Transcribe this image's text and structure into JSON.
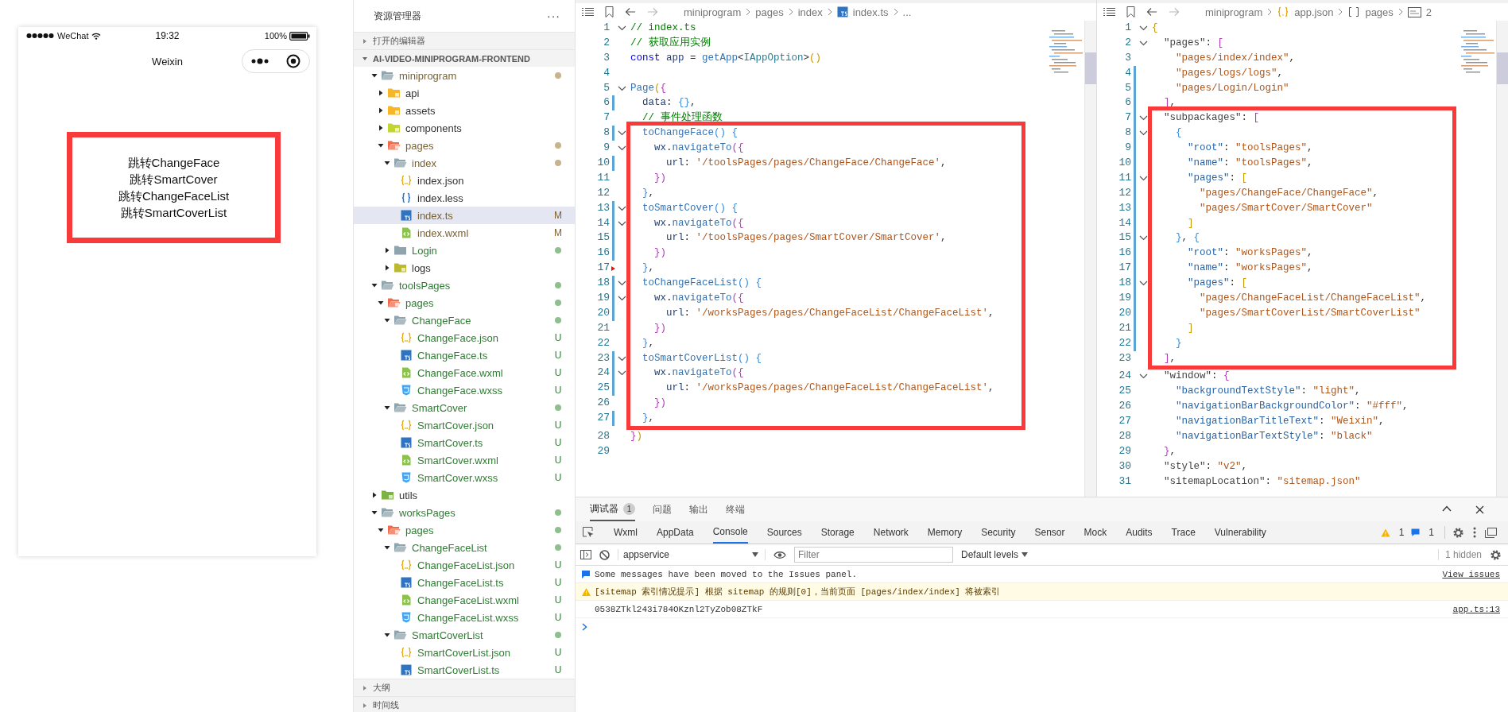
{
  "simulator": {
    "status_bar": {
      "carrier": "WeChat",
      "time": "19:32",
      "battery": "100%"
    },
    "nav_title": "Weixin",
    "page": {
      "framed": true,
      "links": [
        "跳转ChangeFace",
        "跳转SmartCover",
        "跳转ChangeFaceList",
        "跳转SmartCoverList"
      ]
    }
  },
  "explorer": {
    "title": "资源管理器",
    "more": "···",
    "sections": [
      {
        "title": "打开的编辑器",
        "expanded": false
      },
      {
        "title": "AI-VIDEO-MINIPROGRAM-FRONTEND",
        "expanded": true,
        "tree": [
          {
            "name": "miniprogram",
            "kind": "folder",
            "expanded": true,
            "selected": false,
            "modified": true,
            "untracked": false,
            "children": [
              {
                "name": "api",
                "kind": "api",
                "expanded": false,
                "selected": false,
                "modified": false,
                "untracked": false
              },
              {
                "name": "assets",
                "kind": "assets",
                "expanded": false,
                "selected": false,
                "modified": false,
                "untracked": false
              },
              {
                "name": "components",
                "kind": "components",
                "expanded": false,
                "selected": false,
                "modified": false,
                "untracked": false
              },
              {
                "name": "pages",
                "kind": "pages",
                "expanded": true,
                "selected": false,
                "modified": true,
                "untracked": false,
                "children": [
                  {
                    "name": "index",
                    "kind": "folder",
                    "expanded": true,
                    "selected": false,
                    "modified": true,
                    "untracked": false,
                    "children": [
                      {
                        "name": "index.json",
                        "kind": "json",
                        "selected": false,
                        "modified": false,
                        "untracked": false
                      },
                      {
                        "name": "index.less",
                        "kind": "less",
                        "selected": false,
                        "modified": false,
                        "untracked": false
                      },
                      {
                        "name": "index.ts",
                        "kind": "ts",
                        "selected": true,
                        "modified": true,
                        "untracked": false,
                        "badge": "M"
                      },
                      {
                        "name": "index.wxml",
                        "kind": "wxml",
                        "selected": false,
                        "modified": true,
                        "untracked": false,
                        "badge": "M"
                      }
                    ]
                  },
                  {
                    "name": "Login",
                    "kind": "folder",
                    "expanded": false,
                    "selected": false,
                    "modified": false,
                    "untracked": true
                  },
                  {
                    "name": "logs",
                    "kind": "logs",
                    "expanded": false,
                    "selected": false,
                    "modified": false,
                    "untracked": false
                  }
                ]
              }
            ]
          },
          {
            "name": "toolsPages",
            "kind": "folder",
            "expanded": true,
            "selected": false,
            "modified": false,
            "untracked": true,
            "children": [
              {
                "name": "pages",
                "kind": "pages",
                "expanded": true,
                "selected": false,
                "modified": false,
                "untracked": true,
                "children": [
                  {
                    "name": "ChangeFace",
                    "kind": "folder",
                    "expanded": true,
                    "selected": false,
                    "modified": false,
                    "untracked": true,
                    "children": [
                      {
                        "name": "ChangeFace.json",
                        "kind": "json",
                        "selected": false,
                        "modified": false,
                        "untracked": true,
                        "badge": "U"
                      },
                      {
                        "name": "ChangeFace.ts",
                        "kind": "ts",
                        "selected": false,
                        "modified": false,
                        "untracked": true,
                        "badge": "U"
                      },
                      {
                        "name": "ChangeFace.wxml",
                        "kind": "wxml",
                        "selected": false,
                        "modified": false,
                        "untracked": true,
                        "badge": "U"
                      },
                      {
                        "name": "ChangeFace.wxss",
                        "kind": "wxss",
                        "selected": false,
                        "modified": false,
                        "untracked": true,
                        "badge": "U"
                      }
                    ]
                  },
                  {
                    "name": "SmartCover",
                    "kind": "folder",
                    "expanded": true,
                    "selected": false,
                    "modified": false,
                    "untracked": true,
                    "children": [
                      {
                        "name": "SmartCover.json",
                        "kind": "json",
                        "selected": false,
                        "modified": false,
                        "untracked": true,
                        "badge": "U"
                      },
                      {
                        "name": "SmartCover.ts",
                        "kind": "ts",
                        "selected": false,
                        "modified": false,
                        "untracked": true,
                        "badge": "U"
                      },
                      {
                        "name": "SmartCover.wxml",
                        "kind": "wxml",
                        "selected": false,
                        "modified": false,
                        "untracked": true,
                        "badge": "U"
                      },
                      {
                        "name": "SmartCover.wxss",
                        "kind": "wxss",
                        "selected": false,
                        "modified": false,
                        "untracked": true,
                        "badge": "U"
                      }
                    ]
                  }
                ]
              }
            ]
          },
          {
            "name": "utils",
            "kind": "utils",
            "expanded": false,
            "selected": false,
            "modified": false,
            "untracked": false
          },
          {
            "name": "worksPages",
            "kind": "folder",
            "expanded": true,
            "selected": false,
            "modified": false,
            "untracked": true,
            "children": [
              {
                "name": "pages",
                "kind": "pages",
                "expanded": true,
                "selected": false,
                "modified": false,
                "untracked": true,
                "children": [
                  {
                    "name": "ChangeFaceList",
                    "kind": "folder",
                    "expanded": true,
                    "selected": false,
                    "modified": false,
                    "untracked": true,
                    "children": [
                      {
                        "name": "ChangeFaceList.json",
                        "kind": "json",
                        "selected": false,
                        "modified": false,
                        "untracked": true,
                        "badge": "U"
                      },
                      {
                        "name": "ChangeFaceList.ts",
                        "kind": "ts",
                        "selected": false,
                        "modified": false,
                        "untracked": true,
                        "badge": "U"
                      },
                      {
                        "name": "ChangeFaceList.wxml",
                        "kind": "wxml",
                        "selected": false,
                        "modified": false,
                        "untracked": true,
                        "badge": "U"
                      },
                      {
                        "name": "ChangeFaceList.wxss",
                        "kind": "wxss",
                        "selected": false,
                        "modified": false,
                        "untracked": true,
                        "badge": "U"
                      }
                    ]
                  },
                  {
                    "name": "SmartCoverList",
                    "kind": "folder",
                    "expanded": true,
                    "selected": false,
                    "modified": false,
                    "untracked": true,
                    "children": [
                      {
                        "name": "SmartCoverList.json",
                        "kind": "json",
                        "selected": false,
                        "modified": false,
                        "untracked": true,
                        "badge": "U"
                      },
                      {
                        "name": "SmartCoverList.ts",
                        "kind": "ts",
                        "selected": false,
                        "modified": false,
                        "untracked": true,
                        "badge": "U"
                      }
                    ]
                  }
                ]
              }
            ]
          }
        ]
      },
      {
        "title": "大纲",
        "expanded": false
      },
      {
        "title": "时间线",
        "expanded": false
      }
    ]
  },
  "editors": [
    {
      "breadcrumb": [
        {
          "text": "miniprogram"
        },
        {
          "text": "pages"
        },
        {
          "text": "index"
        },
        {
          "text": "index.ts",
          "kind": "ts"
        },
        {
          "text": "..."
        }
      ],
      "blocks": [
        {
          "framed": false,
          "lines": [
            {
              "number": "1",
              "foldable": true,
              "tokens": [
                {
                  "text": "// index.ts",
                  "kind": "comment"
                }
              ]
            },
            {
              "number": "2",
              "foldable": false,
              "tokens": [
                {
                  "text": "// 获取应用实例",
                  "kind": "comment"
                }
              ]
            },
            {
              "number": "3",
              "foldable": false,
              "tokens": [
                {
                  "text": "const",
                  "kind": "keyword"
                },
                {
                  "text": " app",
                  "kind": "variable"
                },
                {
                  "text": " = ",
                  "kind": "plain"
                },
                {
                  "text": "getApp",
                  "kind": "function"
                },
                {
                  "text": "<",
                  "kind": "plain"
                },
                {
                  "text": "IAppOption",
                  "kind": "type"
                },
                {
                  "text": ">",
                  "kind": "plain"
                },
                {
                  "text": "()",
                  "kind": "bracket1"
                }
              ]
            },
            {
              "number": "4",
              "foldable": false
            },
            {
              "number": "5",
              "foldable": true,
              "tokens": [
                {
                  "text": "Page",
                  "kind": "function"
                },
                {
                  "text": "(",
                  "kind": "bracket1"
                },
                {
                  "text": "{",
                  "kind": "bracket2"
                }
              ]
            },
            {
              "number": "6",
              "foldable": false,
              "changed": true,
              "tokens": [
                {
                  "text": "  data",
                  "kind": "variable"
                },
                {
                  "text": ": ",
                  "kind": "plain"
                },
                {
                  "text": "{}",
                  "kind": "bracket3"
                },
                {
                  "text": ",",
                  "kind": "plain"
                }
              ]
            },
            {
              "number": "7",
              "foldable": false,
              "tokens": [
                {
                  "text": "  // 事件处理函数",
                  "kind": "comment"
                }
              ]
            }
          ]
        },
        {
          "framed": true,
          "lines": [
            {
              "number": "8",
              "foldable": true,
              "changed": true,
              "tokens": [
                {
                  "text": "  toChangeFace",
                  "kind": "function"
                },
                {
                  "text": "() {",
                  "kind": "bracket3"
                }
              ]
            },
            {
              "number": "9",
              "foldable": true,
              "tokens": [
                {
                  "text": "    wx",
                  "kind": "variable"
                },
                {
                  "text": ".",
                  "kind": "plain"
                },
                {
                  "text": "navigateTo",
                  "kind": "function"
                },
                {
                  "text": "({",
                  "kind": "bracket2"
                }
              ]
            },
            {
              "number": "10",
              "foldable": false,
              "changed": true,
              "tokens": [
                {
                  "text": "      url",
                  "kind": "variable"
                },
                {
                  "text": ": ",
                  "kind": "plain"
                },
                {
                  "text": "'/toolsPages/pages/ChangeFace/ChangeFace'",
                  "kind": "string"
                },
                {
                  "text": ",",
                  "kind": "plain"
                }
              ]
            },
            {
              "number": "11",
              "foldable": false,
              "tokens": [
                {
                  "text": "    })",
                  "kind": "bracket2"
                }
              ]
            },
            {
              "number": "12",
              "foldable": false,
              "tokens": [
                {
                  "text": "  }",
                  "kind": "bracket3"
                },
                {
                  "text": ",",
                  "kind": "plain"
                }
              ]
            },
            {
              "number": "13",
              "foldable": true,
              "changed": true,
              "tokens": [
                {
                  "text": "  toSmartCover",
                  "kind": "function"
                },
                {
                  "text": "() {",
                  "kind": "bracket3"
                }
              ]
            },
            {
              "number": "14",
              "foldable": true,
              "changed": true,
              "tokens": [
                {
                  "text": "    wx",
                  "kind": "variable"
                },
                {
                  "text": ".",
                  "kind": "plain"
                },
                {
                  "text": "navigateTo",
                  "kind": "function"
                },
                {
                  "text": "({",
                  "kind": "bracket2"
                }
              ]
            },
            {
              "number": "15",
              "foldable": false,
              "changed": true,
              "tokens": [
                {
                  "text": "      url",
                  "kind": "variable"
                },
                {
                  "text": ": ",
                  "kind": "plain"
                },
                {
                  "text": "'/toolsPages/pages/SmartCover/SmartCover'",
                  "kind": "string"
                },
                {
                  "text": ",",
                  "kind": "plain"
                }
              ]
            },
            {
              "number": "16",
              "foldable": false,
              "changed": true,
              "tokens": [
                {
                  "text": "    })",
                  "kind": "bracket2"
                }
              ]
            },
            {
              "number": "17",
              "foldable": false,
              "deleted": true,
              "tokens": [
                {
                  "text": "  }",
                  "kind": "bracket3"
                },
                {
                  "text": ",",
                  "kind": "plain"
                }
              ]
            },
            {
              "number": "18",
              "foldable": true,
              "changed": true,
              "tokens": [
                {
                  "text": "  toChangeFaceList",
                  "kind": "function"
                },
                {
                  "text": "() {",
                  "kind": "bracket3"
                }
              ]
            },
            {
              "number": "19",
              "foldable": true,
              "changed": true,
              "tokens": [
                {
                  "text": "    wx",
                  "kind": "variable"
                },
                {
                  "text": ".",
                  "kind": "plain"
                },
                {
                  "text": "navigateTo",
                  "kind": "function"
                },
                {
                  "text": "({",
                  "kind": "bracket2"
                }
              ]
            },
            {
              "number": "20",
              "foldable": false,
              "changed": true,
              "tokens": [
                {
                  "text": "      url",
                  "kind": "variable"
                },
                {
                  "text": ": ",
                  "kind": "plain"
                },
                {
                  "text": "'/worksPages/pages/ChangeFaceList/ChangeFaceList'",
                  "kind": "string"
                },
                {
                  "text": ",",
                  "kind": "plain"
                }
              ]
            },
            {
              "number": "21",
              "foldable": false,
              "tokens": [
                {
                  "text": "    })",
                  "kind": "bracket2"
                }
              ]
            },
            {
              "number": "22",
              "foldable": false,
              "tokens": [
                {
                  "text": "  }",
                  "kind": "bracket3"
                },
                {
                  "text": ",",
                  "kind": "plain"
                }
              ]
            },
            {
              "number": "23",
              "foldable": true,
              "changed": true,
              "tokens": [
                {
                  "text": "  toSmartCoverList",
                  "kind": "function"
                },
                {
                  "text": "() {",
                  "kind": "bracket3"
                }
              ]
            },
            {
              "number": "24",
              "foldable": true,
              "changed": true,
              "tokens": [
                {
                  "text": "    wx",
                  "kind": "variable"
                },
                {
                  "text": ".",
                  "kind": "plain"
                },
                {
                  "text": "navigateTo",
                  "kind": "function"
                },
                {
                  "text": "({",
                  "kind": "bracket2"
                }
              ]
            },
            {
              "number": "25",
              "foldable": false,
              "changed": true,
              "tokens": [
                {
                  "text": "      url",
                  "kind": "variable"
                },
                {
                  "text": ": ",
                  "kind": "plain"
                },
                {
                  "text": "'/worksPages/pages/ChangeFaceList/ChangeFaceList'",
                  "kind": "string"
                },
                {
                  "text": ",",
                  "kind": "plain"
                }
              ]
            },
            {
              "number": "26",
              "foldable": false,
              "tokens": [
                {
                  "text": "    })",
                  "kind": "bracket2"
                }
              ]
            },
            {
              "number": "27",
              "foldable": false,
              "changed": true,
              "tokens": [
                {
                  "text": "  }",
                  "kind": "bracket3"
                },
                {
                  "text": ",",
                  "kind": "plain"
                }
              ]
            }
          ]
        },
        {
          "framed": false,
          "lines": [
            {
              "number": "28",
              "foldable": false,
              "tokens": [
                {
                  "text": "}",
                  "kind": "bracket2"
                },
                {
                  "text": ")",
                  "kind": "bracket1"
                }
              ]
            },
            {
              "number": "29",
              "foldable": false
            }
          ]
        }
      ]
    },
    {
      "breadcrumb": [
        {
          "text": "miniprogram"
        },
        {
          "text": "app.json",
          "kind": "json"
        },
        {
          "text": "pages",
          "kind": "array"
        },
        {
          "text": "2",
          "kind": "string"
        }
      ],
      "blocks": [
        {
          "framed": false,
          "lines": [
            {
              "number": "1",
              "foldable": true,
              "tokens": [
                {
                  "text": "{",
                  "kind": "bracket1"
                }
              ]
            },
            {
              "number": "2",
              "foldable": true,
              "tokens": [
                {
                  "text": "  \"pages\"",
                  "kind": "topkey"
                },
                {
                  "text": ": ",
                  "kind": "plain"
                },
                {
                  "text": "[",
                  "kind": "bracket2"
                }
              ]
            },
            {
              "number": "3",
              "foldable": false,
              "tokens": [
                {
                  "text": "    \"pages/index/index\"",
                  "kind": "string"
                },
                {
                  "text": ",",
                  "kind": "plain"
                }
              ]
            },
            {
              "number": "4",
              "foldable": false,
              "changed": true,
              "tokens": [
                {
                  "text": "    \"pages/logs/logs\"",
                  "kind": "string"
                },
                {
                  "text": ",",
                  "kind": "plain"
                }
              ]
            },
            {
              "number": "5",
              "foldable": false,
              "changed": true,
              "tokens": [
                {
                  "text": "    \"pages/Login/Login\"",
                  "kind": "string"
                }
              ]
            },
            {
              "number": "6",
              "foldable": false,
              "changed": true,
              "tokens": [
                {
                  "text": "  ]",
                  "kind": "bracket2"
                },
                {
                  "text": ",",
                  "kind": "plain"
                }
              ]
            }
          ]
        },
        {
          "framed": true,
          "lines": [
            {
              "number": "7",
              "foldable": true,
              "changed": true,
              "tokens": [
                {
                  "text": "  \"subpackages\"",
                  "kind": "topkey"
                },
                {
                  "text": ": ",
                  "kind": "plain"
                },
                {
                  "text": "[",
                  "kind": "bracket2"
                }
              ]
            },
            {
              "number": "8",
              "foldable": true,
              "changed": true,
              "tokens": [
                {
                  "text": "    {",
                  "kind": "bracket3"
                }
              ]
            },
            {
              "number": "9",
              "foldable": false,
              "changed": true,
              "tokens": [
                {
                  "text": "      \"root\"",
                  "kind": "key"
                },
                {
                  "text": ": ",
                  "kind": "plain"
                },
                {
                  "text": "\"toolsPages\"",
                  "kind": "string"
                },
                {
                  "text": ",",
                  "kind": "plain"
                }
              ]
            },
            {
              "number": "10",
              "foldable": false,
              "changed": true,
              "tokens": [
                {
                  "text": "      \"name\"",
                  "kind": "key"
                },
                {
                  "text": ": ",
                  "kind": "plain"
                },
                {
                  "text": "\"toolsPages\"",
                  "kind": "string"
                },
                {
                  "text": ",",
                  "kind": "plain"
                }
              ]
            },
            {
              "number": "11",
              "foldable": true,
              "changed": true,
              "tokens": [
                {
                  "text": "      \"pages\"",
                  "kind": "key"
                },
                {
                  "text": ": ",
                  "kind": "plain"
                },
                {
                  "text": "[",
                  "kind": "bracket1"
                }
              ]
            },
            {
              "number": "12",
              "foldable": false,
              "changed": true,
              "tokens": [
                {
                  "text": "        \"pages/ChangeFace/ChangeFace\"",
                  "kind": "string"
                },
                {
                  "text": ",",
                  "kind": "plain"
                }
              ]
            },
            {
              "number": "13",
              "foldable": false,
              "changed": true,
              "tokens": [
                {
                  "text": "        \"pages/SmartCover/SmartCover\"",
                  "kind": "string"
                }
              ]
            },
            {
              "number": "14",
              "foldable": false,
              "changed": true,
              "tokens": [
                {
                  "text": "      ]",
                  "kind": "bracket1"
                }
              ]
            },
            {
              "number": "15",
              "foldable": true,
              "changed": true,
              "tokens": [
                {
                  "text": "    }",
                  "kind": "bracket3"
                },
                {
                  "text": ", ",
                  "kind": "plain"
                },
                {
                  "text": "{",
                  "kind": "bracket3"
                }
              ]
            },
            {
              "number": "16",
              "foldable": false,
              "changed": true,
              "tokens": [
                {
                  "text": "      \"root\"",
                  "kind": "key"
                },
                {
                  "text": ": ",
                  "kind": "plain"
                },
                {
                  "text": "\"worksPages\"",
                  "kind": "string"
                },
                {
                  "text": ",",
                  "kind": "plain"
                }
              ]
            },
            {
              "number": "17",
              "foldable": false,
              "changed": true,
              "tokens": [
                {
                  "text": "      \"name\"",
                  "kind": "key"
                },
                {
                  "text": ": ",
                  "kind": "plain"
                },
                {
                  "text": "\"worksPages\"",
                  "kind": "string"
                },
                {
                  "text": ",",
                  "kind": "plain"
                }
              ]
            },
            {
              "number": "18",
              "foldable": true,
              "changed": true,
              "tokens": [
                {
                  "text": "      \"pages\"",
                  "kind": "key"
                },
                {
                  "text": ": ",
                  "kind": "plain"
                },
                {
                  "text": "[",
                  "kind": "bracket1"
                }
              ]
            },
            {
              "number": "19",
              "foldable": false,
              "changed": true,
              "tokens": [
                {
                  "text": "        \"pages/ChangeFaceList/ChangeFaceList\"",
                  "kind": "string"
                },
                {
                  "text": ",",
                  "kind": "plain"
                }
              ]
            },
            {
              "number": "20",
              "foldable": false,
              "changed": true,
              "tokens": [
                {
                  "text": "        \"pages/SmartCoverList/SmartCoverList\"",
                  "kind": "string"
                }
              ]
            },
            {
              "number": "21",
              "foldable": false,
              "changed": true,
              "tokens": [
                {
                  "text": "      ]",
                  "kind": "bracket1"
                }
              ]
            },
            {
              "number": "22",
              "foldable": false,
              "changed": true,
              "tokens": [
                {
                  "text": "    }",
                  "kind": "bracket3"
                }
              ]
            },
            {
              "number": "23",
              "foldable": false,
              "tokens": [
                {
                  "text": "  ]",
                  "kind": "bracket2"
                },
                {
                  "text": ",",
                  "kind": "plain"
                }
              ]
            }
          ]
        },
        {
          "framed": false,
          "lines": [
            {
              "number": "24",
              "foldable": true,
              "tokens": [
                {
                  "text": "  \"window\"",
                  "kind": "topkey"
                },
                {
                  "text": ": ",
                  "kind": "plain"
                },
                {
                  "text": "{",
                  "kind": "bracket2"
                }
              ]
            },
            {
              "number": "25",
              "foldable": false,
              "tokens": [
                {
                  "text": "    \"backgroundTextStyle\"",
                  "kind": "key"
                },
                {
                  "text": ": ",
                  "kind": "plain"
                },
                {
                  "text": "\"light\"",
                  "kind": "string"
                },
                {
                  "text": ",",
                  "kind": "plain"
                }
              ]
            },
            {
              "number": "26",
              "foldable": false,
              "tokens": [
                {
                  "text": "    \"navigationBarBackgroundColor\"",
                  "kind": "key"
                },
                {
                  "text": ": ",
                  "kind": "plain"
                },
                {
                  "text": "\"#fff\"",
                  "kind": "string"
                },
                {
                  "text": ",",
                  "kind": "plain"
                }
              ]
            },
            {
              "number": "27",
              "foldable": false,
              "tokens": [
                {
                  "text": "    \"navigationBarTitleText\"",
                  "kind": "key"
                },
                {
                  "text": ": ",
                  "kind": "plain"
                },
                {
                  "text": "\"Weixin\"",
                  "kind": "string"
                },
                {
                  "text": ",",
                  "kind": "plain"
                }
              ]
            },
            {
              "number": "28",
              "foldable": false,
              "tokens": [
                {
                  "text": "    \"navigationBarTextStyle\"",
                  "kind": "key"
                },
                {
                  "text": ": ",
                  "kind": "plain"
                },
                {
                  "text": "\"black\"",
                  "kind": "string"
                }
              ]
            },
            {
              "number": "29",
              "foldable": false,
              "tokens": [
                {
                  "text": "  }",
                  "kind": "bracket2"
                },
                {
                  "text": ",",
                  "kind": "plain"
                }
              ]
            },
            {
              "number": "30",
              "foldable": false,
              "tokens": [
                {
                  "text": "  \"style\"",
                  "kind": "topkey"
                },
                {
                  "text": ": ",
                  "kind": "plain"
                },
                {
                  "text": "\"v2\"",
                  "kind": "string"
                },
                {
                  "text": ",",
                  "kind": "plain"
                }
              ]
            },
            {
              "number": "31",
              "foldable": false,
              "tokens": [
                {
                  "text": "  \"sitemapLocation\"",
                  "kind": "topkey"
                },
                {
                  "text": ": ",
                  "kind": "plain"
                },
                {
                  "text": "\"sitemap.json\"",
                  "kind": "string"
                }
              ]
            }
          ]
        }
      ]
    }
  ],
  "panel": {
    "tabs": [
      {
        "label": "调试器",
        "badge": "1",
        "selected": true
      },
      {
        "label": "问题",
        "selected": false
      },
      {
        "label": "输出",
        "selected": false
      },
      {
        "label": "终端",
        "selected": false
      }
    ],
    "devtools": {
      "tabs": [
        {
          "label": "Wxml",
          "selected": false
        },
        {
          "label": "AppData",
          "selected": false
        },
        {
          "label": "Console",
          "selected": true
        },
        {
          "label": "Sources",
          "selected": false
        },
        {
          "label": "Storage",
          "selected": false
        },
        {
          "label": "Network",
          "selected": false
        },
        {
          "label": "Memory",
          "selected": false
        },
        {
          "label": "Security",
          "selected": false
        },
        {
          "label": "Sensor",
          "selected": false
        },
        {
          "label": "Mock",
          "selected": false
        },
        {
          "label": "Audits",
          "selected": false
        },
        {
          "label": "Trace",
          "selected": false
        },
        {
          "label": "Vulnerability",
          "selected": false
        }
      ],
      "warnings": "1",
      "messages": "1",
      "context": "appservice",
      "filter_placeholder": "Filter",
      "levels": "Default levels",
      "hidden": "1 hidden",
      "console": [
        {
          "kind": "info",
          "text": "Some messages have been moved to the Issues panel.",
          "link": "View issues"
        },
        {
          "kind": "warning",
          "text": "[sitemap 索引情况提示] 根据 sitemap 的规则[0]，当前页面 [pages/index/index] 将被索引"
        },
        {
          "kind": "log",
          "text": "0538ZTkl243i784OKznl2TyZob08ZTkF",
          "source": "app.ts:13"
        }
      ]
    }
  }
}
